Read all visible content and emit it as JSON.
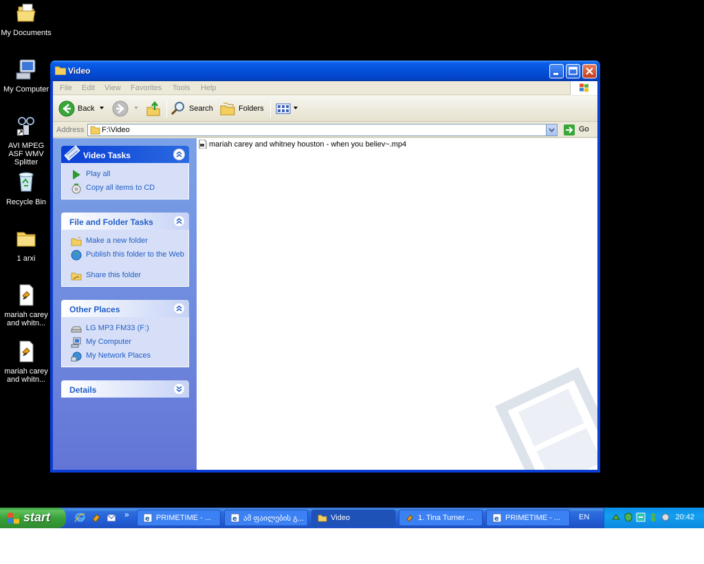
{
  "desktop": {
    "icons": [
      {
        "label": "My Documents"
      },
      {
        "label": "My Computer"
      },
      {
        "label": "AVI MPEG ASF WMV Splitter"
      },
      {
        "label": "Recycle Bin"
      },
      {
        "label": "1 arxi"
      },
      {
        "label": "mariah carey and whitn..."
      },
      {
        "label": "mariah carey and whitn..."
      }
    ]
  },
  "window": {
    "title": "Video",
    "menu": [
      "File",
      "Edit",
      "View",
      "Favorites",
      "Tools",
      "Help"
    ],
    "toolbar": {
      "back": "Back",
      "search": "Search",
      "folders": "Folders"
    },
    "address": {
      "label": "Address",
      "value": "F:\\Video",
      "go": "Go"
    },
    "panels": {
      "video_tasks": {
        "title": "Video Tasks",
        "items": [
          "Play all",
          "Copy all items to CD"
        ]
      },
      "file_folder_tasks": {
        "title": "File and Folder Tasks",
        "items": [
          "Make a new folder",
          "Publish this folder to the Web",
          "Share this folder"
        ]
      },
      "other_places": {
        "title": "Other Places",
        "items": [
          "LG MP3 FM33 (F:)",
          "My Computer",
          "My Network Places"
        ]
      },
      "details": {
        "title": "Details"
      }
    },
    "files": [
      {
        "name": "mariah carey and whitney houston - when you believ~.mp4"
      }
    ]
  },
  "taskbar": {
    "start": "start",
    "tasks": [
      {
        "label": "PRIMETIME - ..."
      },
      {
        "label": "ამ ფაილების გ..."
      },
      {
        "label": "Video"
      },
      {
        "label": "1. Tina Turner ..."
      },
      {
        "label": "PRIMETIME - ..."
      }
    ],
    "language": "EN",
    "clock": "20:42"
  }
}
